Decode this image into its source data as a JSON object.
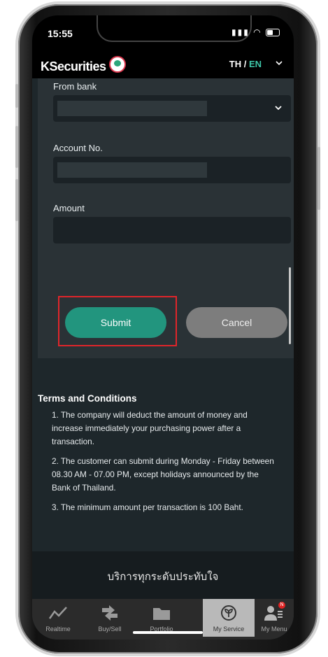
{
  "status": {
    "time": "15:55"
  },
  "header": {
    "brand": "KSecurities",
    "lang_th": "TH /",
    "lang_en": "EN"
  },
  "form": {
    "from_bank_label": "From bank",
    "account_label": "Account No.",
    "amount_label": "Amount",
    "amount_value": "",
    "submit_label": "Submit",
    "cancel_label": "Cancel"
  },
  "terms": {
    "title": "Terms and Conditions",
    "items": [
      "1. The company will deduct the amount of money and increase immediately your purchasing power after a transaction.",
      "2. The customer can submit during Monday - Friday between 08.30 AM - 07.00 PM, except holidays announced by the Bank of Thailand.",
      "3. The minimum amount per transaction is 100 Baht."
    ]
  },
  "tagline": "บริการทุกระดับประทับใจ",
  "tabs": [
    {
      "label": "Realtime",
      "icon": "chart-line-icon"
    },
    {
      "label": "Buy/Sell",
      "icon": "swap-arrows-icon"
    },
    {
      "label": "Portfolio",
      "icon": "folder-icon"
    },
    {
      "label": "My Service",
      "icon": "coin-plant-icon",
      "active": true
    },
    {
      "label": "My Menu",
      "icon": "user-menu-icon",
      "badge": "N"
    }
  ],
  "colors": {
    "accent": "#22957e",
    "highlight": "#e0252a",
    "lang_active": "#3ec6a8"
  }
}
